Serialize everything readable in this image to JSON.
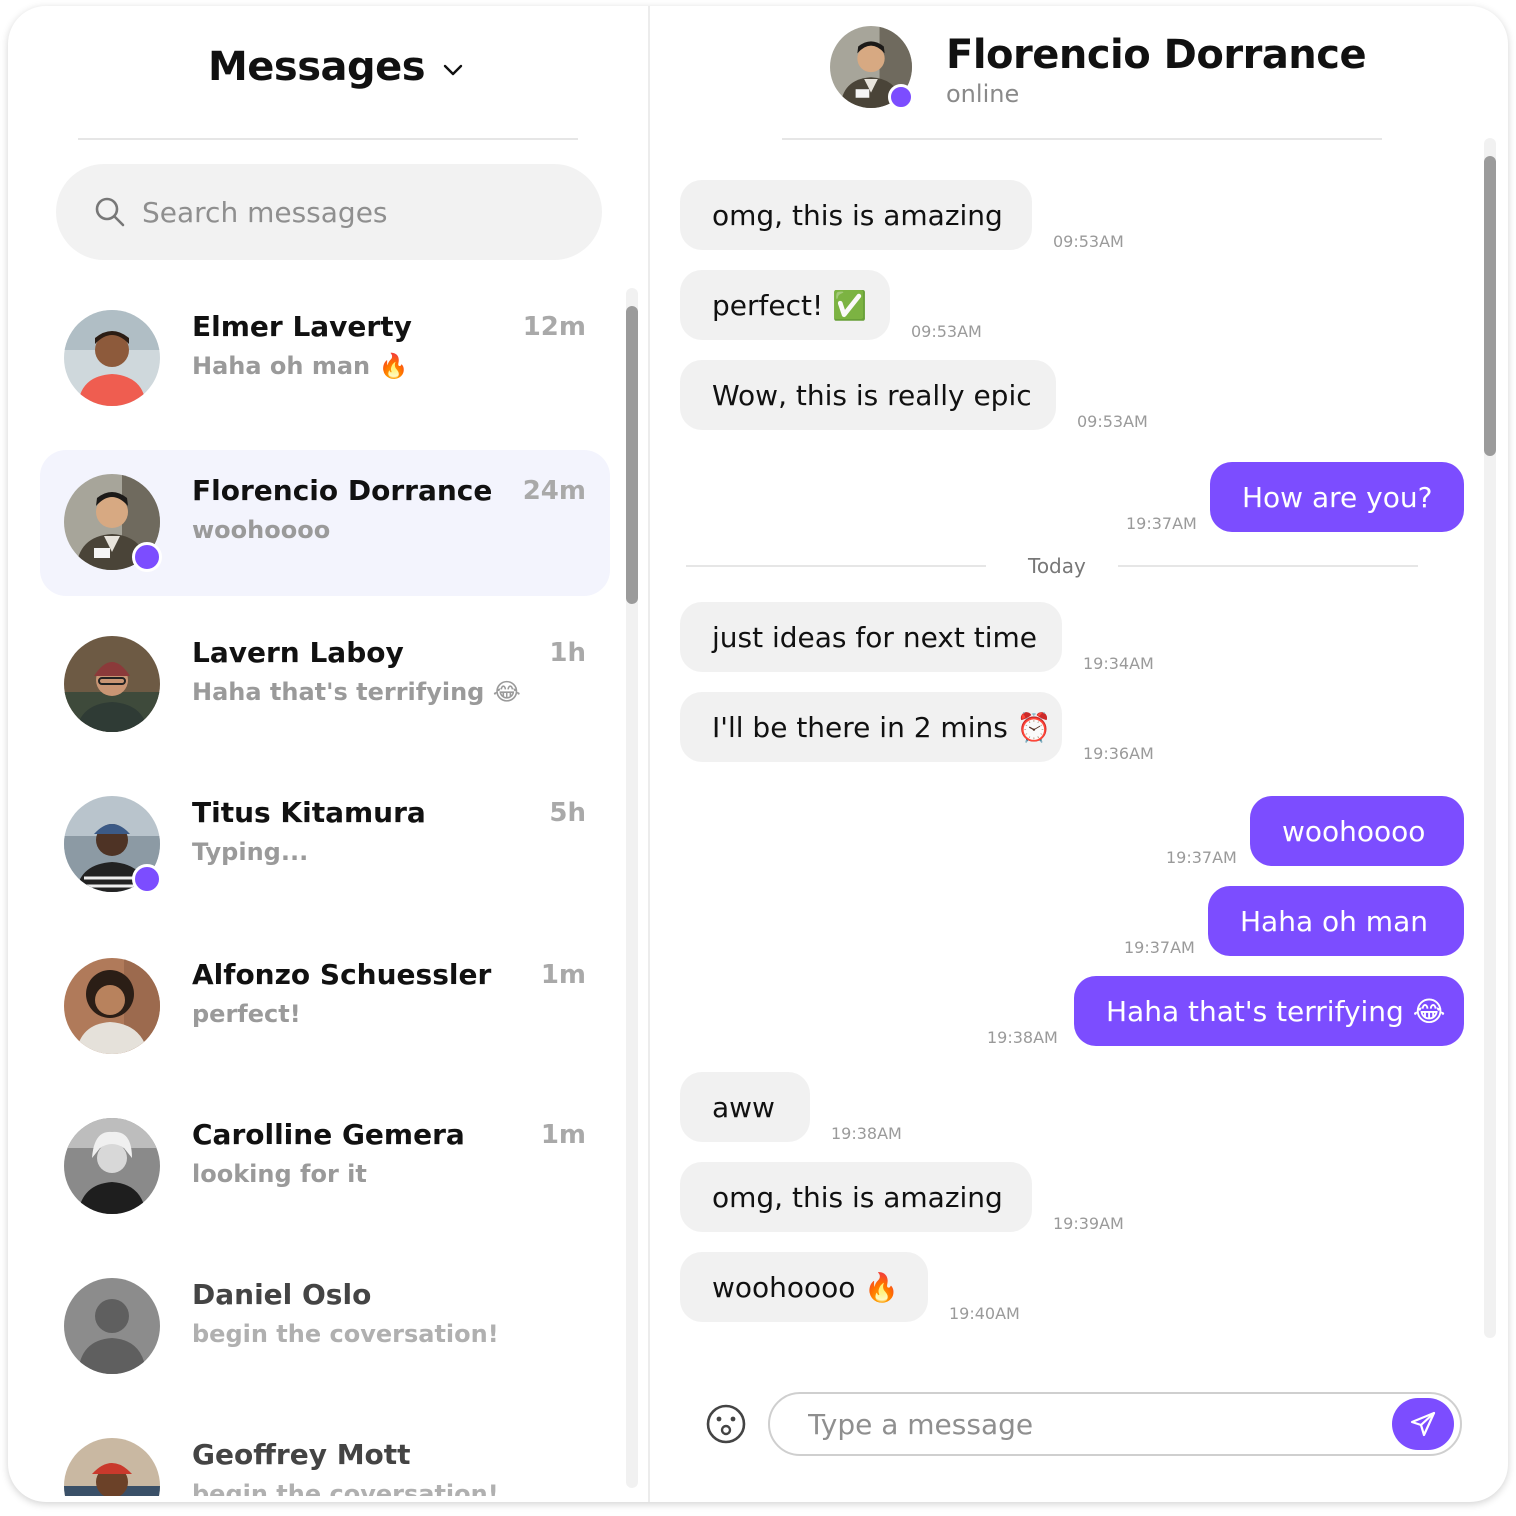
{
  "left": {
    "title": "Messages",
    "search_placeholder": "Search messages"
  },
  "conversations": [
    {
      "name": "Elmer Laverty",
      "preview": "Haha oh man 🔥",
      "time": "12m",
      "online": false,
      "active": false,
      "avatar": "photo-man-red-shirt"
    },
    {
      "name": "Florencio Dorrance",
      "preview": "woohoooo",
      "time": "24m",
      "online": true,
      "active": true,
      "avatar": "photo-man-suit"
    },
    {
      "name": "Lavern Laboy",
      "preview": "Haha that's terrifying 😂",
      "time": "1h",
      "online": false,
      "active": false,
      "avatar": "photo-man-beanie"
    },
    {
      "name": "Titus Kitamura",
      "preview": "Typing...",
      "time": "5h",
      "online": true,
      "active": false,
      "avatar": "photo-man-cap"
    },
    {
      "name": "Alfonzo Schuessler",
      "preview": "perfect!",
      "time": "1m",
      "online": false,
      "active": false,
      "avatar": "photo-man-curly"
    },
    {
      "name": "Carolline Gemera",
      "preview": "looking for it",
      "time": "1m",
      "online": false,
      "active": false,
      "avatar": "photo-woman-bw"
    },
    {
      "name": "Daniel Oslo",
      "preview": "begin the coversation!",
      "time": "",
      "online": false,
      "active": false,
      "avatar": "placeholder-person"
    },
    {
      "name": "Geoffrey Mott",
      "preview": "begin the coversation!",
      "time": "",
      "online": false,
      "active": false,
      "avatar": "photo-man-dreads"
    }
  ],
  "chat": {
    "name": "Florencio Dorrance",
    "status": "online",
    "day_separator": "Today",
    "messages": [
      {
        "dir": "in",
        "text": "omg, this is amazing",
        "time": "09:53AM"
      },
      {
        "dir": "in",
        "text": "perfect! ✅",
        "time": "09:53AM"
      },
      {
        "dir": "in",
        "text": "Wow, this is really epic",
        "time": "09:53AM"
      },
      {
        "dir": "out",
        "text": "How are you?",
        "time": "19:37AM"
      },
      {
        "dir": "in",
        "text": "just ideas for next time",
        "time": "19:34AM"
      },
      {
        "dir": "in",
        "text": "I'll be there in 2 mins ⏰",
        "time": "19:36AM"
      },
      {
        "dir": "out",
        "text": "woohoooo",
        "time": "19:37AM"
      },
      {
        "dir": "out",
        "text": "Haha oh man",
        "time": "19:37AM"
      },
      {
        "dir": "out",
        "text": "Haha that's terrifying 😂",
        "time": "19:38AM"
      },
      {
        "dir": "in",
        "text": "aww",
        "time": "19:38AM"
      },
      {
        "dir": "in",
        "text": "omg, this is amazing",
        "time": "19:39AM"
      },
      {
        "dir": "in",
        "text": "woohoooo 🔥",
        "time": "19:40AM"
      }
    ],
    "compose_placeholder": "Type a message"
  },
  "colors": {
    "accent": "#7c4dff",
    "incoming_bubble": "#f1f1f1",
    "active_row": "#f3f4fd"
  },
  "icons": {
    "title_menu": "chevron-down-icon",
    "search": "search-icon",
    "emoji": "emoji-icon",
    "send": "send-icon"
  }
}
